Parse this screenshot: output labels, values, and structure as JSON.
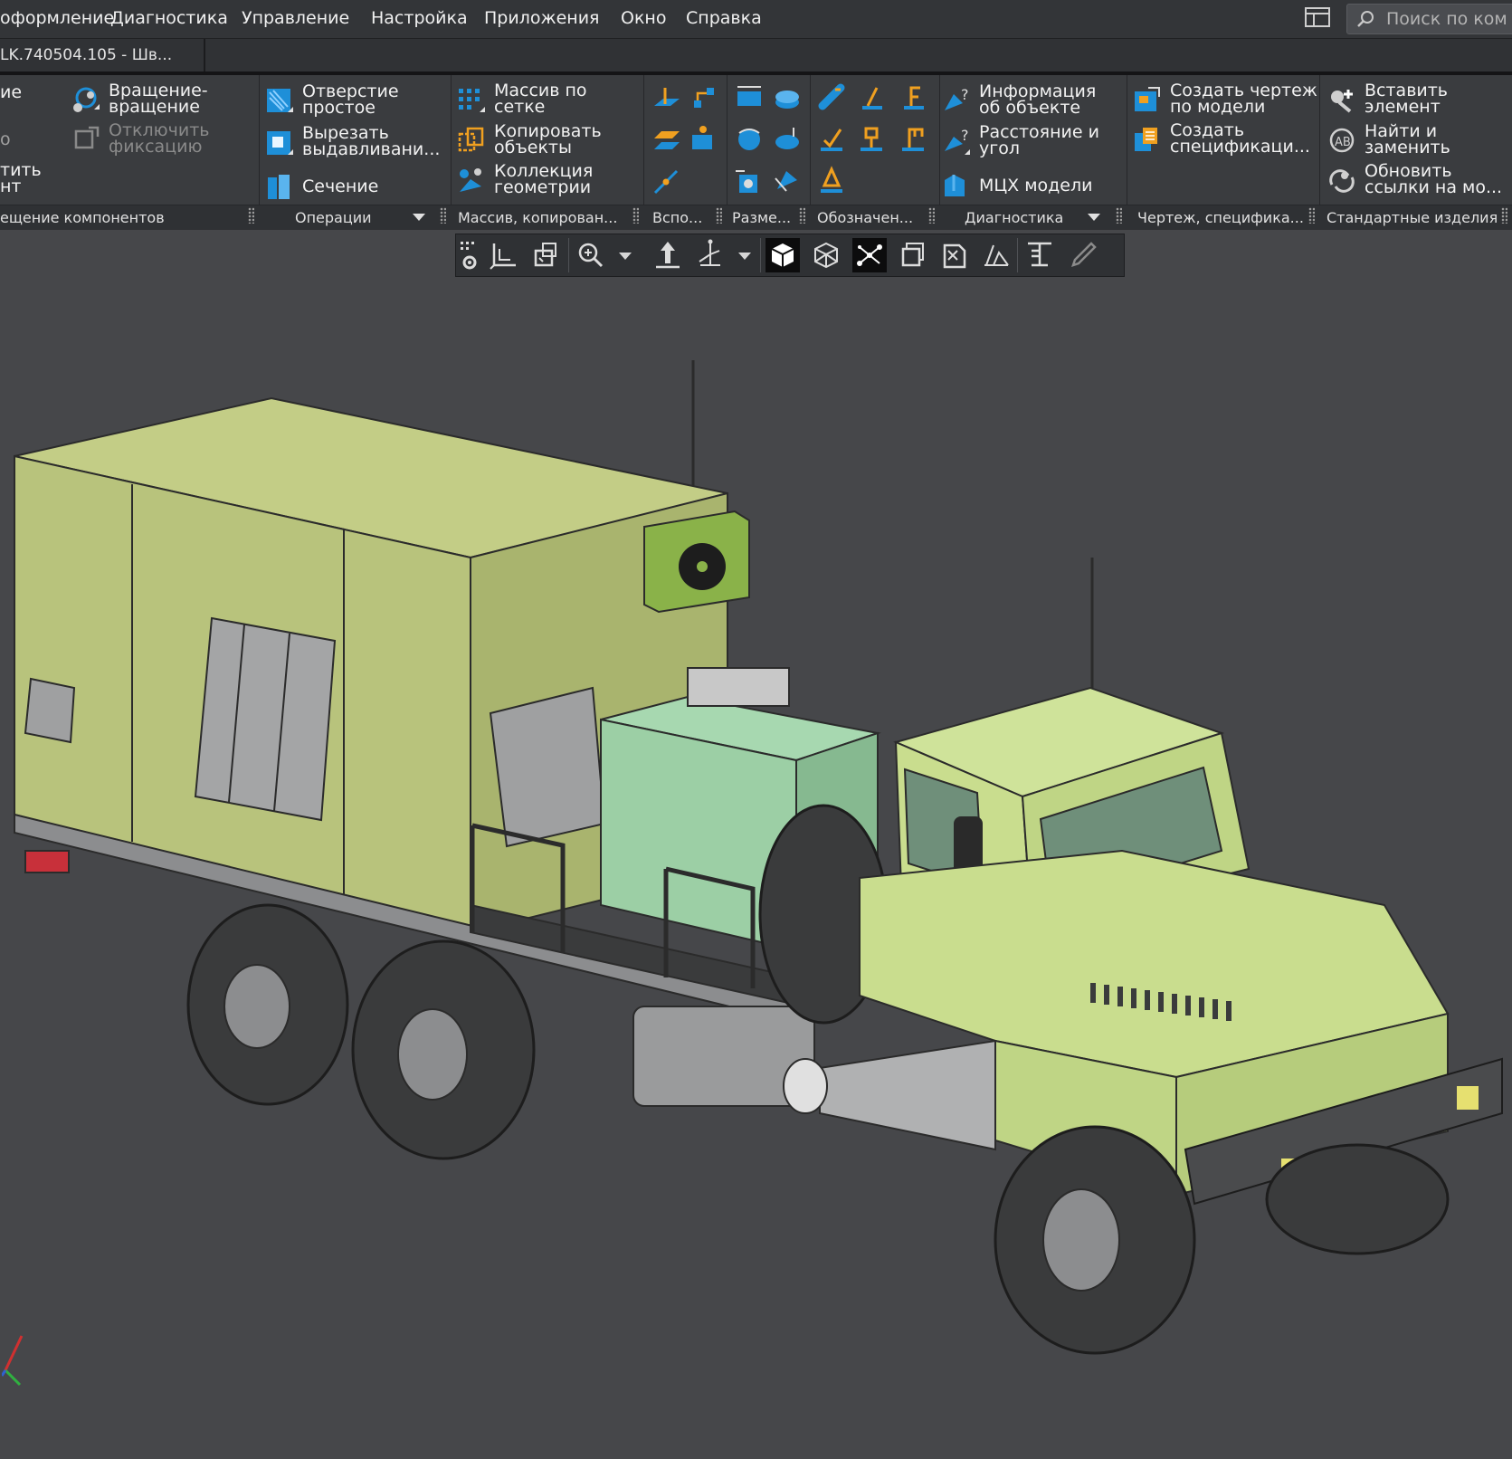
{
  "menu": {
    "items": [
      "оформление",
      "Диагностика",
      "Управление",
      "Настройка",
      "Приложения",
      "Окно",
      "Справка"
    ],
    "search_placeholder": "Поиск по ком"
  },
  "document_tab": {
    "label": "LK.740504.105 - Шв..."
  },
  "ribbon": {
    "panels": [
      {
        "label": "ещение компонентов",
        "buttons": [
          {
            "label": "ие",
            "icon": "partial-icon",
            "enabled": true
          },
          {
            "label": "о",
            "icon": "partial-icon",
            "enabled": true
          },
          {
            "label": "тить\nнт",
            "icon": "partial-icon",
            "enabled": true
          },
          {
            "label": "Вращение-\nвращение",
            "icon": "rotation-rotation-icon",
            "enabled": true
          },
          {
            "label": "Отключить\nфиксацию",
            "icon": "disable-fixation-icon",
            "enabled": false
          }
        ]
      },
      {
        "label": "Операции",
        "buttons": [
          {
            "label": "Отверстие\nпростое",
            "icon": "simple-hole-icon",
            "enabled": true
          },
          {
            "label": "Вырезать\nвыдавливани...",
            "icon": "extrude-cut-icon",
            "enabled": true
          },
          {
            "label": "Сечение",
            "icon": "section-icon",
            "enabled": true
          }
        ]
      },
      {
        "label": "Массив, копирован...",
        "buttons": [
          {
            "label": "Массив по\nсетке",
            "icon": "grid-pattern-icon",
            "enabled": true
          },
          {
            "label": "Копировать\nобъекты",
            "icon": "copy-objects-icon",
            "enabled": true
          },
          {
            "label": "Коллекция\nгеометрии",
            "icon": "geometry-collection-icon",
            "enabled": true
          }
        ]
      },
      {
        "label": "Вспо...",
        "icons": [
          "plane-offset-icon",
          "axis-icon",
          "plane-icon",
          "point-icon",
          "line-icon"
        ]
      },
      {
        "label": "Разме...",
        "icons": [
          "linear-dimension-icon",
          "diameter-dimension-icon",
          "angular-dimension-icon",
          "radial-dimension-icon",
          "auto-dimension-icon",
          "chain-dimension-icon"
        ]
      },
      {
        "label": "Обозначен...",
        "icons": [
          "roughness-icon",
          "datum-icon",
          "leader-icon",
          "weld-icon",
          "base-icon",
          "tolerance-icon",
          "marking-icon"
        ]
      },
      {
        "label": "Диагностика",
        "buttons": [
          {
            "label": "Информация\nоб объекте",
            "icon": "object-info-icon",
            "enabled": true
          },
          {
            "label": "Расстояние и\nугол",
            "icon": "distance-angle-icon",
            "enabled": true
          },
          {
            "label": "МЦХ модели",
            "icon": "mass-properties-icon",
            "enabled": true
          }
        ]
      },
      {
        "label": "Чертеж, специфика...",
        "buttons": [
          {
            "label": "Создать чертеж\nпо модели",
            "icon": "create-drawing-icon",
            "enabled": true
          },
          {
            "label": "Создать\nспецификаци...",
            "icon": "create-specification-icon",
            "enabled": true
          }
        ]
      },
      {
        "label": "Стандартные изделия",
        "buttons": [
          {
            "label": "Вставить\nэлемент",
            "icon": "insert-element-icon",
            "enabled": true
          },
          {
            "label": "Найти и\nзаменить",
            "icon": "find-replace-icon",
            "enabled": true
          },
          {
            "label": "Обновить\nссылки на мо...",
            "icon": "update-links-icon",
            "enabled": true
          }
        ]
      }
    ]
  },
  "view_toolbar": {
    "icons": [
      "view-settings-icon",
      "orientation-icon",
      "view-from-normal-icon",
      "zoom-icon",
      "pan-icon",
      "rotate-icon",
      "shaded-icon",
      "wireframe-icon",
      "shaded-edges-icon",
      "section-view-icon",
      "hide-icon",
      "perspective-icon",
      "measure-icon",
      "eyedropper-icon"
    ],
    "active": [
      "shaded-icon",
      "shaded-edges-icon"
    ]
  },
  "viewport": {
    "background": "#46474a",
    "model": "truck-assembly",
    "colors": {
      "body_box": "#b7c27a",
      "cab": "#c9dd8e",
      "generator": "#9ccfa5",
      "tires": "#3a3b3c",
      "frame": "#8c8d8f"
    }
  },
  "colors": {
    "menubar": "#333538",
    "ribbon": "#3a3c3f",
    "accent_blue": "#1e8fd8",
    "accent_orange": "#f0a020"
  }
}
